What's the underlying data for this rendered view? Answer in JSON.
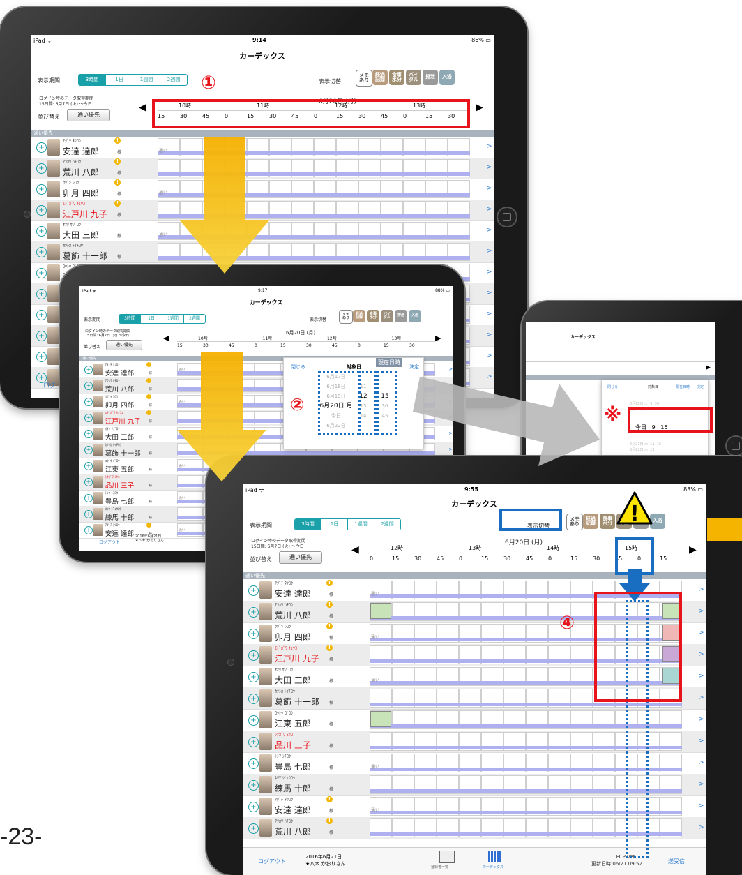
{
  "page_number": "-23-",
  "annotations": {
    "step1": "①",
    "step2": "②",
    "step4": "④",
    "note": "※",
    "warning_glyph": "!"
  },
  "app": {
    "title": "カーデックス",
    "display_period_label": "表示期間",
    "period_tabs": [
      "3時間",
      "1日",
      "1週間",
      "2週間"
    ],
    "toggle_label": "表示切替",
    "icon_buttons": [
      {
        "label": "メモ\nあり",
        "color": "#ffffff",
        "fg": "#444444",
        "icon": "memo-icon"
      },
      {
        "label": "経過\n記録",
        "color": "#b79b7c",
        "icon": "progress-record-icon"
      },
      {
        "label": "食事\n水分",
        "color": "#a08e70",
        "icon": "meal-icon"
      },
      {
        "label": "バイ\nタル",
        "color": "#9c8f7c",
        "icon": "vital-icon"
      },
      {
        "label": "排泄",
        "color": "#9a9a9a",
        "icon": "excretion-icon"
      },
      {
        "label": "入浴",
        "color": "#8ea8b4",
        "icon": "bath-icon"
      }
    ],
    "login_period_text": "ログイン時のデータ取得期間\n15日間: 6月7日 (火) 〜今日",
    "sort_label": "並び替え",
    "sort_button": "通い優先",
    "section_header": "通い優先",
    "logout": "ログアウト",
    "date_footer": "2016年6月21日\n★八木 かおりさん",
    "nav_list": "登録者一覧",
    "nav_kardex": "カーデックス",
    "send_receive": "送受信",
    "version_text": "FCP Ver. ...\n更新日時:06/21 09:52",
    "cell_text": "通い",
    "chevron": ">"
  },
  "screen1": {
    "status_left": "iPad ᯤ",
    "time": "9:14",
    "battery": "86% ▭",
    "date_header": "6月20日 (月)",
    "hours": [
      "10時",
      "11時",
      "12時",
      "13時"
    ],
    "minutes": [
      "15",
      "30",
      "45",
      "0",
      "15",
      "30",
      "45",
      "0",
      "15",
      "30",
      "45",
      "0",
      "15",
      "30"
    ]
  },
  "screen2": {
    "status_left": "iPad ᯤ",
    "time": "9:17",
    "battery": "88% ▭",
    "date_header": "6月20日 (月)",
    "hours": [
      "10時",
      "11時",
      "12時",
      "13時"
    ],
    "minutes": [
      "15",
      "30",
      "45",
      "0",
      "15",
      "30",
      "45",
      "0",
      "15",
      "30"
    ],
    "picker": {
      "close": "閉じる",
      "target_day": "対象日",
      "now_button": "現在日時",
      "decide": "決定",
      "dates": [
        "6月17日",
        "6月18日",
        "6月19日",
        "6月20日 月",
        "今日",
        "6月22日"
      ],
      "hours": [
        "11",
        "12",
        "13",
        "14"
      ],
      "minutes": [
        "15",
        "30",
        "45"
      ]
    }
  },
  "screen3": {
    "picker_today": "今日",
    "picker_hour": "9",
    "picker_min": "15",
    "close": "閉じる",
    "target_day": "対象日",
    "now_button": "現在日時",
    "decide": "決定"
  },
  "screen4": {
    "status_left": "iPad ᯤ",
    "time": "9:55",
    "battery": "83% ▭",
    "date_header": "6月20日 (月)",
    "hours": [
      "12時",
      "13時",
      "14時",
      "15時"
    ],
    "minutes": [
      "0",
      "15",
      "30",
      "45",
      "0",
      "15",
      "30",
      "45",
      "0",
      "15",
      "30",
      "45",
      "0",
      "15"
    ]
  },
  "residents": [
    {
      "kana": "ｱﾀﾞﾁ ﾀﾂﾛｳ",
      "name": "安達 達郎",
      "red": false,
      "warn": true
    },
    {
      "kana": "ｱﾗｶﾜ ﾊﾁﾛｳ",
      "name": "荒川 八郎",
      "red": false,
      "warn": true
    },
    {
      "kana": "ｳﾂﾞｷ ｼﾛｳ",
      "name": "卯月 四郎",
      "red": false,
      "warn": true
    },
    {
      "kana": "ｴﾄﾞｶﾞﾜ ｷｭｳｺ",
      "name": "江戸川 九子",
      "red": true,
      "warn": true
    },
    {
      "kana": "ｵｵﾀ ｻﾌﾞﾛｳ",
      "name": "大田 三郎",
      "red": false,
      "warn": false
    },
    {
      "kana": "ｶﾂｼｶ ﾄｲﾁﾛｳ",
      "name": "葛飾 十一郎",
      "red": false,
      "warn": false
    },
    {
      "kana": "ｺｳﾄｳ ｺﾞﾛｳ",
      "name": "江東 五郎",
      "red": false,
      "warn": false
    },
    {
      "kana": "ｼﾅｶﾞﾜ ﾐﾂｺ",
      "name": "品川 三子",
      "red": true,
      "warn": false
    },
    {
      "kana": "ﾄｼﾏ ｼﾁﾛｳ",
      "name": "豊島 七郎",
      "red": false,
      "warn": false
    },
    {
      "kana": "ﾈﾘﾏ ｼﾞｭｳﾛｳ",
      "name": "練馬 十郎",
      "red": false,
      "warn": false
    }
  ],
  "suffix": "様"
}
